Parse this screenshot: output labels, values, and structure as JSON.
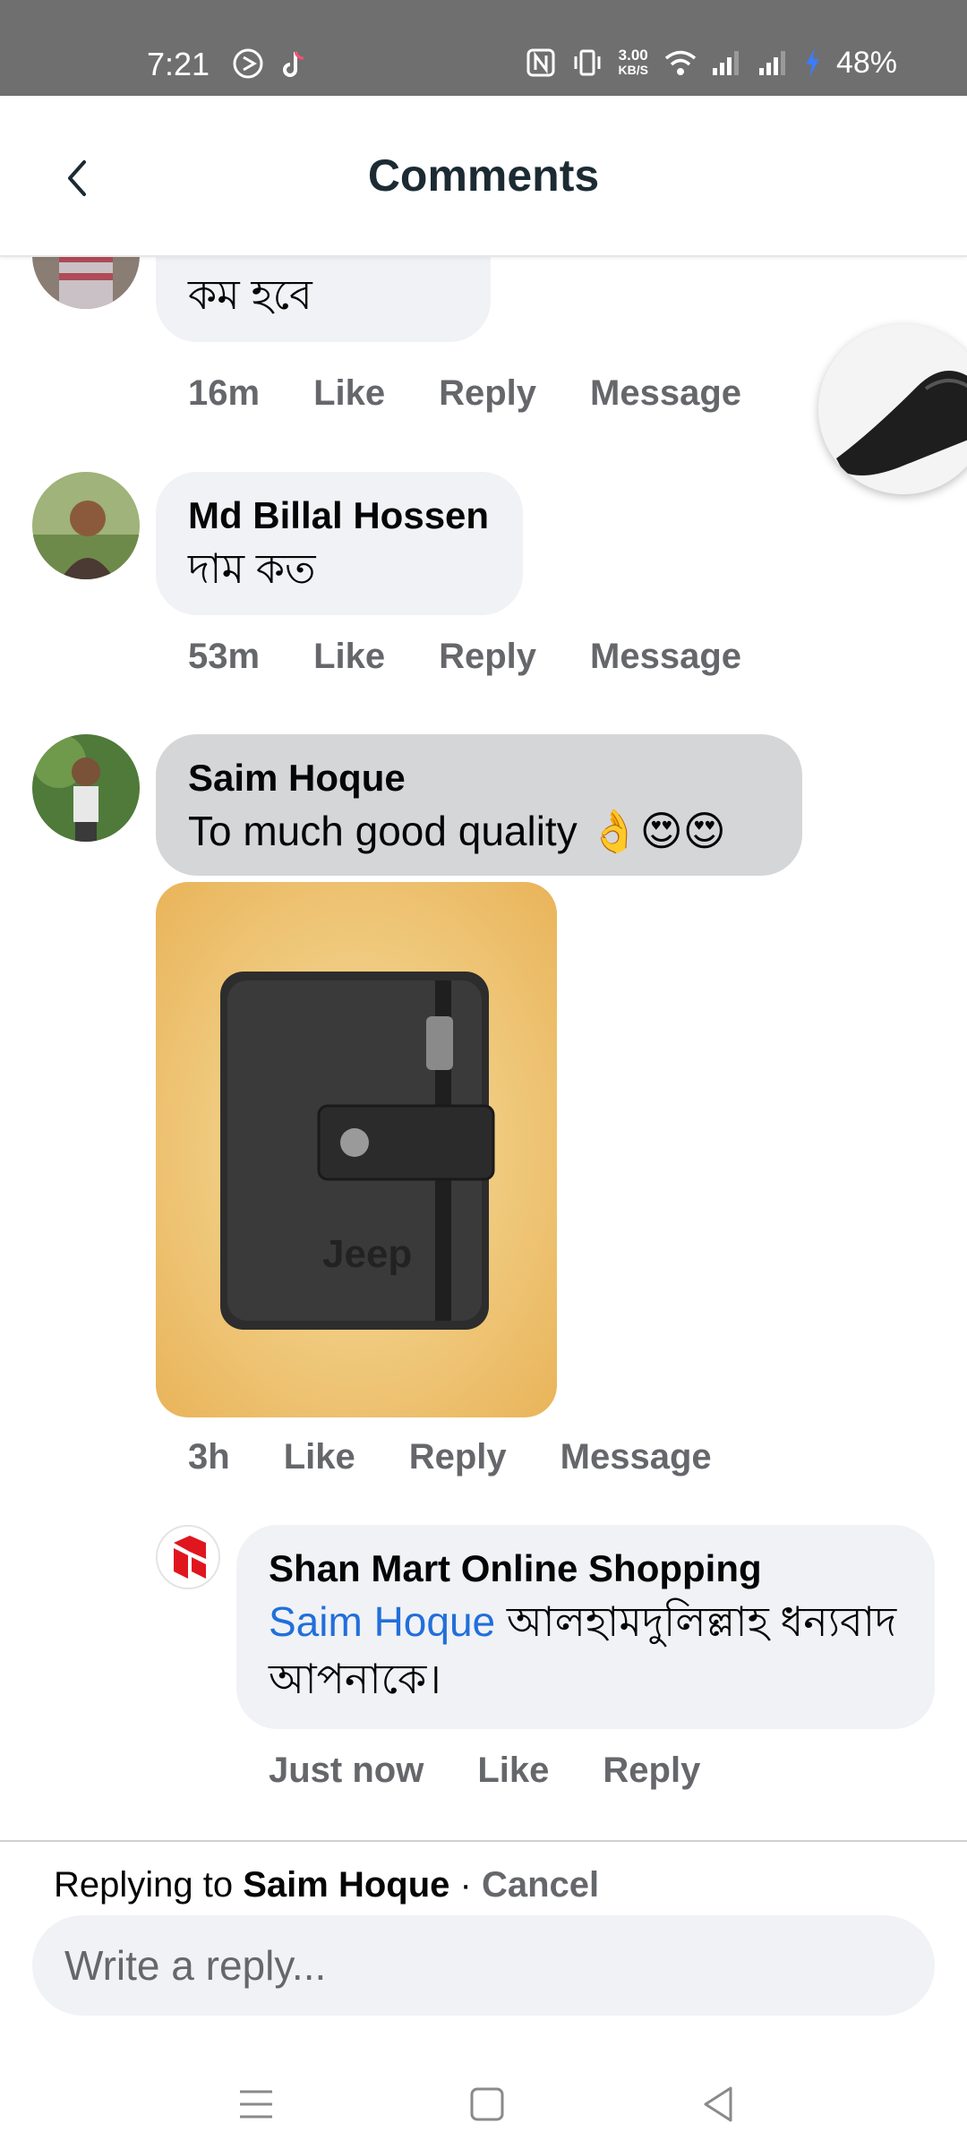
{
  "status_bar": {
    "time": "7:21",
    "net_speed_value": "3.00",
    "net_speed_unit": "KB/S",
    "battery": "48%",
    "icons": [
      "camera-shutter-icon",
      "tiktok-icon",
      "nfc-icon",
      "vibrate-icon",
      "wifi-icon",
      "signal-icon",
      "signal-icon",
      "charging-icon"
    ]
  },
  "header": {
    "title": "Comments",
    "back_icon": "chevron-left-icon"
  },
  "comments": [
    {
      "text": "কম হবে",
      "time": "16m",
      "like_label": "Like",
      "reply_label": "Reply",
      "message_label": "Message"
    },
    {
      "name": "Md Billal Hossen",
      "text": "দাম কত",
      "time": "53m",
      "like_label": "Like",
      "reply_label": "Reply",
      "message_label": "Message"
    },
    {
      "name": "Saim Hoque",
      "text": "To much good quality 👌😍😍",
      "image_text": "Jeep",
      "time": "3h",
      "like_label": "Like",
      "reply_label": "Reply",
      "message_label": "Message"
    }
  ],
  "reply": {
    "name": "Shan Mart Online Shopping",
    "mention": "Saim Hoque",
    "text": "আলহামদুলিল্লাহ ধন্যবাদ আপনাকে।",
    "time": "Just now",
    "like_label": "Like",
    "reply_label": "Reply"
  },
  "reply_bar": {
    "prefix": "Replying to ",
    "target": "Saim Hoque",
    "separator": " · ",
    "cancel_label": "Cancel",
    "placeholder": "Write a reply..."
  },
  "nav_bar": {
    "icons": [
      "menu-icon",
      "home-square-icon",
      "back-triangle-icon"
    ]
  },
  "colors": {
    "status_bar": "#6f6f6f",
    "bubble": "#f0f2f5",
    "bubble_highlight": "#d5d6d8",
    "mention": "#216fdb",
    "muted_text": "#65676b",
    "brand_red": "#e0161e"
  }
}
